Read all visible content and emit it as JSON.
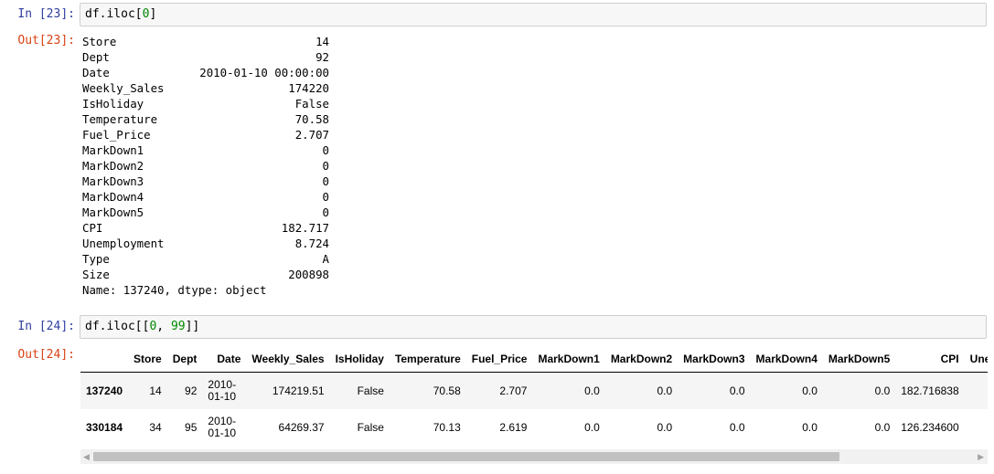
{
  "cells": [
    {
      "in_prompt": "In [23]:",
      "code_prefix": "df.iloc[",
      "code_num": "0",
      "code_suffix": "]",
      "out_prompt": "Out[23]:"
    },
    {
      "in_prompt": "In [24]:",
      "code_prefix": "df.iloc[[",
      "code_num": "0",
      "code_mid": ", ",
      "code_num2": "99",
      "code_suffix": "]]",
      "out_prompt": "Out[24]:"
    }
  ],
  "series": {
    "rows": [
      {
        "key": "Store",
        "value": "14"
      },
      {
        "key": "Dept",
        "value": "92"
      },
      {
        "key": "Date",
        "value": "2010-01-10 00:00:00"
      },
      {
        "key": "Weekly_Sales",
        "value": "174220"
      },
      {
        "key": "IsHoliday",
        "value": "False"
      },
      {
        "key": "Temperature",
        "value": "70.58"
      },
      {
        "key": "Fuel_Price",
        "value": "2.707"
      },
      {
        "key": "MarkDown1",
        "value": "0"
      },
      {
        "key": "MarkDown2",
        "value": "0"
      },
      {
        "key": "MarkDown3",
        "value": "0"
      },
      {
        "key": "MarkDown4",
        "value": "0"
      },
      {
        "key": "MarkDown5",
        "value": "0"
      },
      {
        "key": "CPI",
        "value": "182.717"
      },
      {
        "key": "Unemployment",
        "value": "8.724"
      },
      {
        "key": "Type",
        "value": "A"
      },
      {
        "key": "Size",
        "value": "200898"
      }
    ],
    "footer": "Name: 137240, dtype: object"
  },
  "table": {
    "columns": [
      "",
      "Store",
      "Dept",
      "Date",
      "Weekly_Sales",
      "IsHoliday",
      "Temperature",
      "Fuel_Price",
      "MarkDown1",
      "MarkDown2",
      "MarkDown3",
      "MarkDown4",
      "MarkDown5",
      "CPI",
      "Unemployment"
    ],
    "rows": [
      {
        "index": "137240",
        "store": "14",
        "dept": "92",
        "date_line1": "2010-",
        "date_line2": "01-10",
        "weekly_sales": "174219.51",
        "isholiday": "False",
        "temperature": "70.58",
        "fuel_price": "2.707",
        "md1": "0.0",
        "md2": "0.0",
        "md3": "0.0",
        "md4": "0.0",
        "md5": "0.0",
        "cpi": "182.716838",
        "unemployment": ""
      },
      {
        "index": "330184",
        "store": "34",
        "dept": "95",
        "date_line1": "2010-",
        "date_line2": "01-10",
        "weekly_sales": "64269.37",
        "isholiday": "False",
        "temperature": "70.13",
        "fuel_price": "2.619",
        "md1": "0.0",
        "md2": "0.0",
        "md3": "0.0",
        "md4": "0.0",
        "md5": "0.0",
        "cpi": "126.234600",
        "unemployment": ""
      }
    ]
  },
  "scrollbar": {
    "left_arrow": "◀",
    "right_arrow": "▶"
  },
  "colors": {
    "in_prompt": "#303f9f",
    "out_prompt": "#d84315",
    "number_literal": "#008800"
  }
}
